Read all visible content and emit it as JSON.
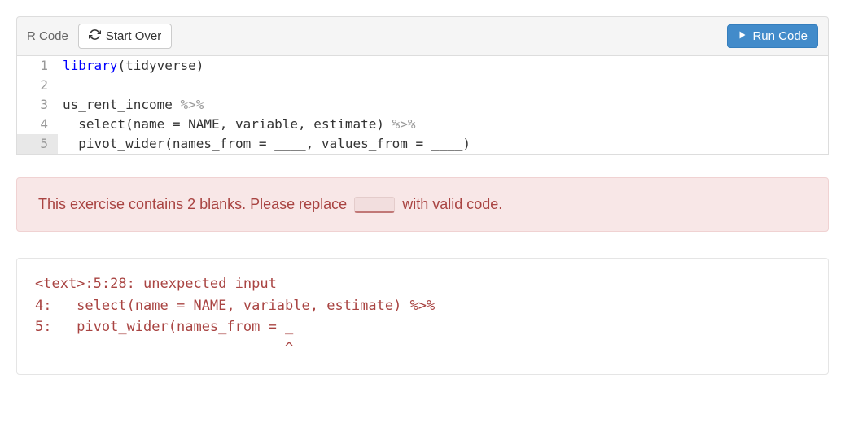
{
  "toolbar": {
    "label": "R Code",
    "start_over": "Start Over",
    "run_code": "Run Code"
  },
  "code": {
    "lines": [
      {
        "num": "1",
        "html": "<span class='kw'>library</span><span class='punct'>(</span><span class='ident'>tidyverse</span><span class='punct'>)</span>"
      },
      {
        "num": "2",
        "html": ""
      },
      {
        "num": "3",
        "html": "<span class='ident'>us_rent_income </span><span class='pipe'>%&gt;%</span>"
      },
      {
        "num": "4",
        "html": "  <span class='ident'>select</span><span class='punct'>(</span><span class='ident'>name </span><span class='punct'>=</span><span class='ident'> NAME</span><span class='punct'>,</span><span class='ident'> variable</span><span class='punct'>,</span><span class='ident'> estimate</span><span class='punct'>)</span> <span class='pipe'>%&gt;%</span>"
      },
      {
        "num": "5",
        "html": "  <span class='ident'>pivot_wider</span><span class='punct'>(</span><span class='ident'>names_from </span><span class='punct'>=</span><span class='ident'> ____</span><span class='punct'>,</span><span class='ident'> values_from </span><span class='punct'>=</span><span class='ident'> ____</span><span class='punct'>)</span>",
        "active": true
      }
    ]
  },
  "alert": {
    "before": "This exercise contains 2 blanks. Please replace",
    "after": "with valid code."
  },
  "output": {
    "text": "<text>:5:28: unexpected input\n4:   select(name = NAME, variable, estimate) %>%\n5:   pivot_wider(names_from = _\n                              ^"
  }
}
